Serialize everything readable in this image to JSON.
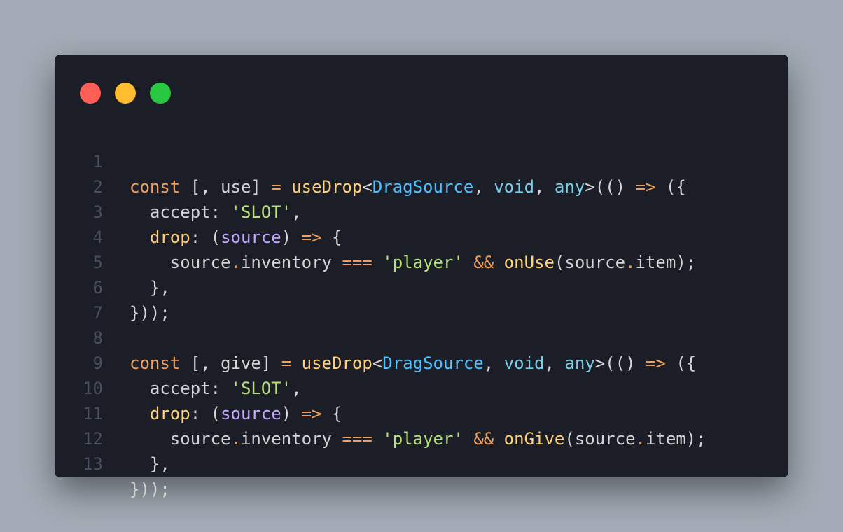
{
  "window": {
    "buttons": [
      "close",
      "minimize",
      "maximize"
    ],
    "colors": {
      "background": "#a3acb6",
      "window": "#1b1d27",
      "close": "#ff5f57",
      "minimize": "#febc2e",
      "maximize": "#28c840",
      "line_number": "#4a4f60",
      "keyword": "#f0a05c",
      "function": "#ffd27a",
      "type": "#4fc1ff",
      "string": "#b5e07a",
      "parameter": "#c3a6ff",
      "plain": "#d4d4d4"
    }
  },
  "code": {
    "line_numbers": [
      "1",
      "2",
      "3",
      "4",
      "5",
      "6",
      "7",
      "8",
      "9",
      "10",
      "11",
      "12",
      "13"
    ],
    "tokens": {
      "l1": [
        "const",
        " [, use] ",
        "=",
        " ",
        "useDrop",
        "<",
        "DragSource",
        ", ",
        "void",
        ", ",
        "any",
        ">(() ",
        "=>",
        " ({"
      ],
      "l2": [
        "  accept: ",
        "'SLOT'",
        ","
      ],
      "l3": [
        "  ",
        "drop",
        ": (",
        "source",
        ") ",
        "=>",
        " {"
      ],
      "l4": [
        "    source",
        ".",
        "inventory ",
        "===",
        " ",
        "'player'",
        " ",
        "&&",
        " ",
        "onUse",
        "(source",
        ".",
        "item);"
      ],
      "l5": [
        "  },"
      ],
      "l6": [
        "}));"
      ],
      "l8": [
        "const",
        " [, give] ",
        "=",
        " ",
        "useDrop",
        "<",
        "DragSource",
        ", ",
        "void",
        ", ",
        "any",
        ">(() ",
        "=>",
        " ({"
      ],
      "l9": [
        "  accept: ",
        "'SLOT'",
        ","
      ],
      "l10": [
        "  ",
        "drop",
        ": (",
        "source",
        ") ",
        "=>",
        " {"
      ],
      "l11": [
        "    source",
        ".",
        "inventory ",
        "===",
        " ",
        "'player'",
        " ",
        "&&",
        " ",
        "onGive",
        "(source",
        ".",
        "item);"
      ],
      "l12": [
        "  },"
      ],
      "l13": [
        "}));"
      ]
    }
  }
}
